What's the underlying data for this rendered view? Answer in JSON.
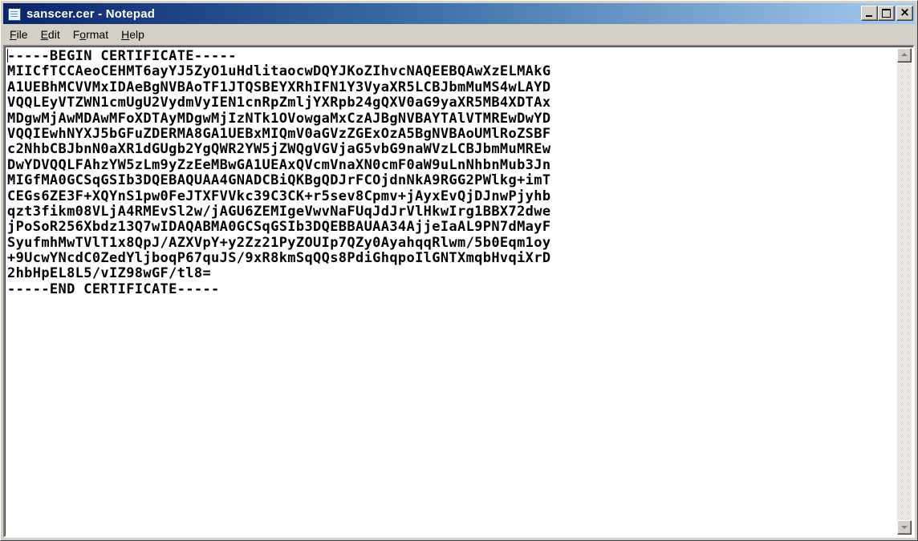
{
  "window": {
    "title": "sanscer.cer - Notepad",
    "icon": "notepad-icon",
    "controls": {
      "minimize": "minimize-icon",
      "maximize": "maximize-icon",
      "close": "×"
    }
  },
  "menu": {
    "file": {
      "accel": "F",
      "rest": "ile"
    },
    "edit": {
      "accel": "E",
      "rest": "dit"
    },
    "format": {
      "pre": "F",
      "accel": "o",
      "rest": "rmat"
    },
    "help": {
      "accel": "H",
      "rest": "elp"
    }
  },
  "document": {
    "lines": [
      "-----BEGIN CERTIFICATE-----",
      "MIICfTCCAeoCEHMT6ayYJ5ZyO1uHdlitaocwDQYJKoZIhvcNAQEEBQAwXzELMAkG",
      "A1UEBhMCVVMxIDAeBgNVBAoTF1JTQSBEYXRhIFN1Y3VyaXR5LCBJbmMuMS4wLAYD",
      "VQQLEyVTZWN1cmUgU2VydmVyIEN1cnRpZmljYXRpb24gQXV0aG9yaXR5MB4XDTAx",
      "MDgwMjAwMDAwMFoXDTAyMDgwMjIzNTk1OVowgaMxCzAJBgNVBAYTAlVTMREwDwYD",
      "VQQIEwhNYXJ5bGFuZDERMA8GA1UEBxMIQmV0aGVzZGExOzA5BgNVBAoUMlRoZSBF",
      "c2NhbCBJbnN0aXR1dGUgb2YgQWR2YW5jZWQgVGVjaG5vbG9naWVzLCBJbmMuMREw",
      "DwYDVQQLFAhzYW5zLm9yZzEeMBwGA1UEAxQVcmVnaXN0cmF0aW9uLnNhbnMub3Jn",
      "MIGfMA0GCSqGSIb3DQEBAQUAA4GNADCBiQKBgQDJrFCOjdnNkA9RGG2PWlkg+imT",
      "CEGs6ZE3F+XQYnS1pw0FeJTXFVVkc39C3CK+r5sev8Cpmv+jAyxEvQjDJnwPjyhb",
      "qzt3fikm08VLjA4RMEvSl2w/jAGU6ZEMIgeVwvNaFUqJdJrVlHkwIrg1BBX72dwe",
      "jPoSoR256Xbdz13Q7wIDAQABMA0GCSqGSIb3DQEBBAUAA34AjjeIaAL9PN7dMayF",
      "SyufmhMwTVlT1x8QpJ/AZXVpY+y2Zz21PyZOUIp7QZy0AyahqqRlwm/5b0Eqm1oy",
      "+9UcwYNcdC0ZedYljboqP67quJS/9xR8kmSqQQs8PdiGhqpoIlGNTXmqbHvqiXrD",
      "2hbHpEL8L5/vIZ98wGF/tl8=",
      "-----END CERTIFICATE-----"
    ]
  },
  "colors": {
    "title_bar_start": "#0a246a",
    "title_bar_end": "#a6caf0",
    "chrome": "#d4d0c8"
  }
}
